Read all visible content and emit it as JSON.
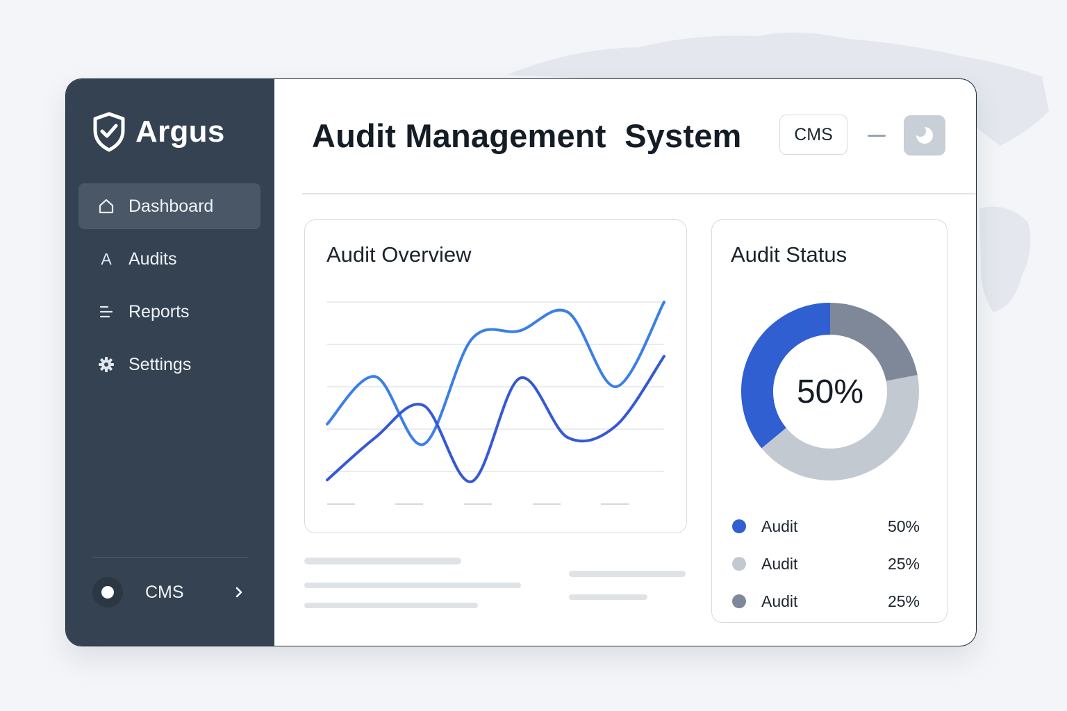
{
  "brand": {
    "name": "Argus"
  },
  "sidebar": {
    "items": [
      {
        "label": "Dashboard",
        "icon": "home-icon",
        "active": true
      },
      {
        "label": "Audits",
        "icon_glyph": "A"
      },
      {
        "label": "Reports",
        "icon": "list-icon"
      },
      {
        "label": "Settings",
        "icon": "gear-icon"
      }
    ],
    "footer": {
      "label": "CMS"
    }
  },
  "header": {
    "title": "Audit Management  System",
    "chip": "CMS"
  },
  "overview": {
    "title": "Audit Overview"
  },
  "status": {
    "title": "Audit Status",
    "center": "50%",
    "legend": [
      {
        "label": "Audit",
        "value": "50%",
        "color": "#2f5fd0"
      },
      {
        "label": "Audit",
        "value": "25%",
        "color": "#c3c9d1"
      },
      {
        "label": "Audit",
        "value": "25%",
        "color": "#7e8898"
      }
    ]
  },
  "chart_data": [
    {
      "type": "line",
      "x": [
        0,
        1,
        2,
        3,
        4,
        5,
        6,
        7
      ],
      "series": [
        {
          "color": "#3b7fe8",
          "values": [
            0.28,
            0.56,
            0.16,
            0.78,
            0.83,
            0.94,
            0.5,
            1.0
          ]
        },
        {
          "color": "#3558d6",
          "values": [
            -0.05,
            0.2,
            0.39,
            -0.06,
            0.55,
            0.2,
            0.27,
            0.68
          ]
        }
      ],
      "ylim": [
        0,
        1
      ],
      "grid": true
    },
    {
      "type": "pie",
      "categories": [
        "Audit",
        "Audit",
        "Audit"
      ],
      "values": [
        50,
        25,
        25
      ],
      "colors": [
        "#2f5fd0",
        "#c3c9d1",
        "#7e8898"
      ],
      "segments": [
        {
          "value": 36,
          "color": "#2f5fd0"
        },
        {
          "value": 42,
          "color": "#c3c9d1"
        },
        {
          "value": 22,
          "color": "#7e8898"
        }
      ],
      "center_label": "50%"
    }
  ]
}
